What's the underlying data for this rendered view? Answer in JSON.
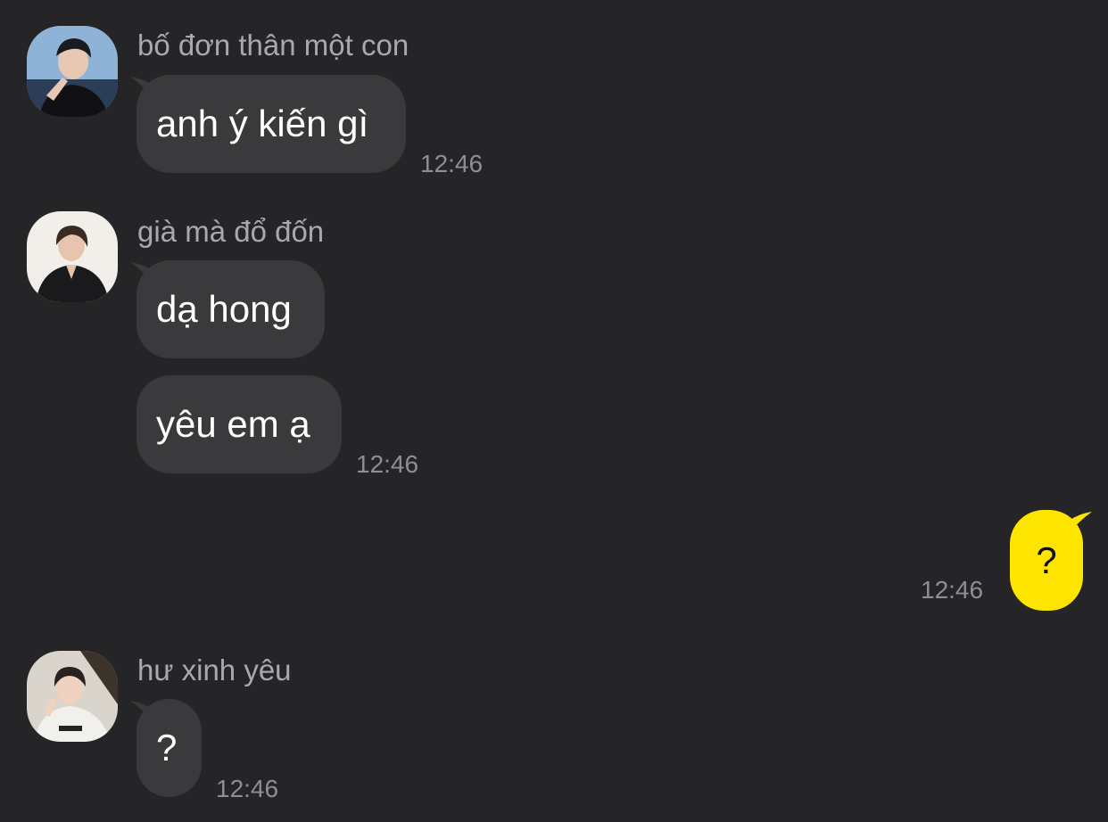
{
  "messages": [
    {
      "sender": "bố đơn thân một con",
      "avatar": "avatar-photo",
      "bubbles": [
        "anh ý kiến gì"
      ],
      "time": "12:46"
    },
    {
      "sender": "già mà đổ đốn",
      "avatar": "avatar-photo",
      "bubbles": [
        "dạ hong",
        "yêu em ạ"
      ],
      "time": "12:46"
    },
    {
      "sender": "",
      "outgoing": true,
      "bubbles": [
        "?"
      ],
      "time": "12:46"
    },
    {
      "sender": "hư xinh yêu",
      "avatar": "avatar-photo",
      "bubbles": [
        "?"
      ],
      "time": "12:46"
    }
  ],
  "colors": {
    "background": "#252527",
    "incoming_bubble": "#3a3a3c",
    "outgoing_bubble": "#fee500",
    "sender_text": "#a9a9ad",
    "time_text": "#8e8e93"
  }
}
